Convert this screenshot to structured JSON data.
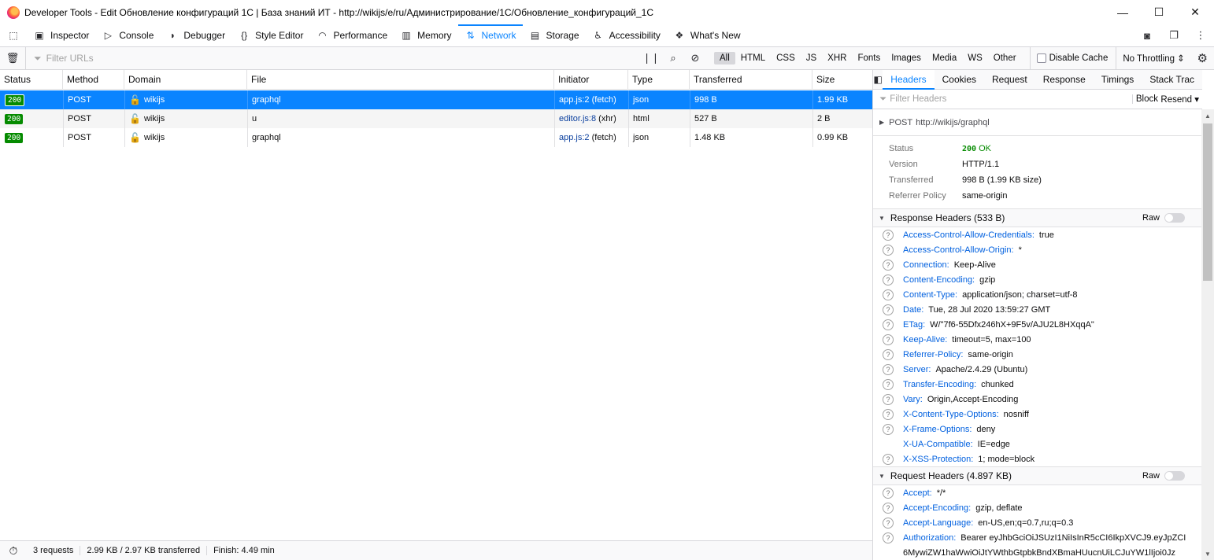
{
  "window": {
    "title": "Developer Tools - Edit Обновление конфигураций 1С | База знаний ИТ - http://wikijs/e/ru/Администрирование/1С/Обновление_конфигураций_1С",
    "minimize": "—",
    "maximize": "☐",
    "close": "✕"
  },
  "toolbox": {
    "tabs": [
      {
        "label": "Inspector",
        "icon": "inspector-icon"
      },
      {
        "label": "Console",
        "icon": "console-icon"
      },
      {
        "label": "Debugger",
        "icon": "debugger-icon"
      },
      {
        "label": "Style Editor",
        "icon": "style-editor-icon"
      },
      {
        "label": "Performance",
        "icon": "performance-icon"
      },
      {
        "label": "Memory",
        "icon": "memory-icon"
      },
      {
        "label": "Network",
        "icon": "network-icon"
      },
      {
        "label": "Storage",
        "icon": "storage-icon"
      },
      {
        "label": "Accessibility",
        "icon": "accessibility-icon"
      },
      {
        "label": "What's New",
        "icon": "whats-new-icon"
      }
    ],
    "active": "Network"
  },
  "filterbar": {
    "placeholder": "Filter URLs",
    "types": [
      "All",
      "HTML",
      "CSS",
      "JS",
      "XHR",
      "Fonts",
      "Images",
      "Media",
      "WS",
      "Other"
    ],
    "selected_type": "All",
    "disable_cache": "Disable Cache",
    "throttling": "No Throttling ⇕"
  },
  "table": {
    "columns": [
      "Status",
      "Method",
      "Domain",
      "File",
      "Initiator",
      "Type",
      "Transferred",
      "Size"
    ],
    "rows": [
      {
        "status": "200",
        "method": "POST",
        "domain": "wikijs",
        "file": "graphql",
        "initiator_link": "app.js:2",
        "initiator_kind": "(fetch)",
        "type": "json",
        "transferred": "998 B",
        "size": "1.99 KB"
      },
      {
        "status": "200",
        "method": "POST",
        "domain": "wikijs",
        "file": "u",
        "initiator_link": "editor.js:8",
        "initiator_kind": "(xhr)",
        "type": "html",
        "transferred": "527 B",
        "size": "2 B"
      },
      {
        "status": "200",
        "method": "POST",
        "domain": "wikijs",
        "file": "graphql",
        "initiator_link": "app.js:2",
        "initiator_kind": "(fetch)",
        "type": "json",
        "transferred": "1.48 KB",
        "size": "0.99 KB"
      }
    ]
  },
  "statusbar": {
    "requests": "3 requests",
    "transferred": "2.99 KB / 2.97 KB transferred",
    "finish": "Finish: 4.49 min"
  },
  "details": {
    "tabs": [
      "Headers",
      "Cookies",
      "Request",
      "Response",
      "Timings",
      "Stack Trac"
    ],
    "active_tab": "Headers",
    "filter_placeholder": "Filter Headers",
    "block": "Block",
    "resend": "Resend ▾",
    "method": "POST",
    "url": "http://wikijs/graphql",
    "summary": {
      "status_label": "Status",
      "status_code": "200",
      "status_text": "OK",
      "version_label": "Version",
      "version": "HTTP/1.1",
      "transferred_label": "Transferred",
      "transferred": "998 B (1.99 KB size)",
      "referrer_label": "Referrer Policy",
      "referrer": "same-origin"
    },
    "raw_label": "Raw",
    "response_headers_title": "Response Headers (533 B)",
    "response_headers": [
      {
        "name": "Access-Control-Allow-Credentials:",
        "value": "true",
        "help": true
      },
      {
        "name": "Access-Control-Allow-Origin:",
        "value": "*",
        "help": true
      },
      {
        "name": "Connection:",
        "value": "Keep-Alive",
        "help": true
      },
      {
        "name": "Content-Encoding:",
        "value": "gzip",
        "help": true
      },
      {
        "name": "Content-Type:",
        "value": "application/json; charset=utf-8",
        "help": true
      },
      {
        "name": "Date:",
        "value": "Tue, 28 Jul 2020 13:59:27 GMT",
        "help": true
      },
      {
        "name": "ETag:",
        "value": "W/\"7f6-55Dfx246hX+9F5v/AJU2L8HXqqA\"",
        "help": true
      },
      {
        "name": "Keep-Alive:",
        "value": "timeout=5, max=100",
        "help": true
      },
      {
        "name": "Referrer-Policy:",
        "value": "same-origin",
        "help": true
      },
      {
        "name": "Server:",
        "value": "Apache/2.4.29 (Ubuntu)",
        "help": true
      },
      {
        "name": "Transfer-Encoding:",
        "value": "chunked",
        "help": true
      },
      {
        "name": "Vary:",
        "value": "Origin,Accept-Encoding",
        "help": true
      },
      {
        "name": "X-Content-Type-Options:",
        "value": "nosniff",
        "help": true
      },
      {
        "name": "X-Frame-Options:",
        "value": "deny",
        "help": true
      },
      {
        "name": "X-UA-Compatible:",
        "value": "IE=edge",
        "help": false
      },
      {
        "name": "X-XSS-Protection:",
        "value": "1; mode=block",
        "help": true
      }
    ],
    "request_headers_title": "Request Headers (4.897 KB)",
    "request_headers": [
      {
        "name": "Accept:",
        "value": "*/*",
        "help": true
      },
      {
        "name": "Accept-Encoding:",
        "value": "gzip, deflate",
        "help": true
      },
      {
        "name": "Accept-Language:",
        "value": "en-US,en;q=0.7,ru;q=0.3",
        "help": true
      },
      {
        "name": "Authorization:",
        "value": "Bearer eyJhbGciOiJSUzI1NiIsInR5cCI6IkpXVCJ9.eyJpZCI",
        "help": true
      }
    ],
    "auth_continuation": "6MywiZW1haWwiOiJtYWthbGtpbkBndXBmaHUucnUiLCJuYW1lIjoi0Jz"
  }
}
